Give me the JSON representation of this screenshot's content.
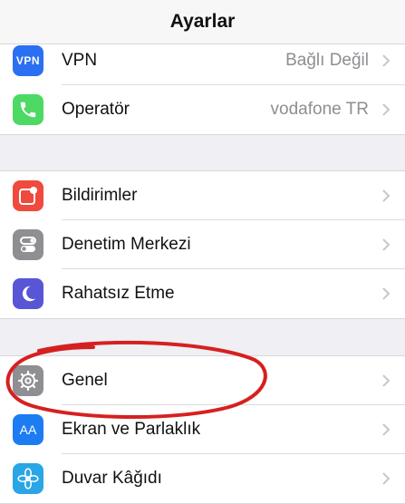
{
  "header": {
    "title": "Ayarlar"
  },
  "group1": [
    {
      "label": "VPN",
      "value": "Bağlı Değil",
      "icon": "vpn-icon",
      "icon_text": "VPN",
      "color": "#2b6ff2"
    },
    {
      "label": "Operatör",
      "value": "vodafone TR",
      "icon": "phone-icon",
      "color": "#4cd964"
    }
  ],
  "group2": [
    {
      "label": "Bildirimler",
      "icon": "notifications-icon",
      "color": "#f0493e"
    },
    {
      "label": "Denetim Merkezi",
      "icon": "control-center-icon",
      "color": "#8e8e93"
    },
    {
      "label": "Rahatsız Etme",
      "icon": "moon-icon",
      "color": "#5856d6"
    }
  ],
  "group3": [
    {
      "label": "Genel",
      "icon": "gear-icon",
      "color": "#8e8e93"
    },
    {
      "label": "Ekran ve Parlaklık",
      "icon": "display-brightness-icon",
      "icon_text": "AA",
      "color": "#1d7cf2"
    },
    {
      "label": "Duvar Kâğıdı",
      "icon": "flower-icon",
      "color": "#2aa6e6"
    }
  ],
  "annotation_color": "#d62020"
}
